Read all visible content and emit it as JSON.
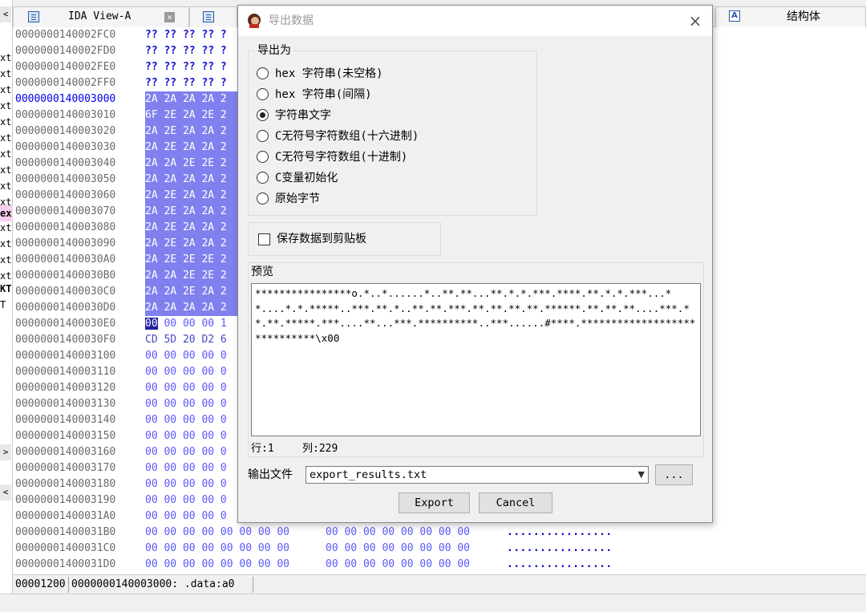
{
  "gutter": {
    "top_button": "<",
    "items": [
      "xt",
      "xt",
      "xt",
      "xt",
      "xt",
      "xt",
      "xt",
      "xt",
      "xt",
      "xt",
      "ex",
      "xt",
      "xt",
      "xt",
      "xt",
      "KT",
      "T"
    ],
    "mid_button": ">",
    "low_button": "<"
  },
  "tabs": {
    "ida_view_label": "IDA View-A",
    "close_glyph": "×",
    "struct_label": "结构体",
    "struct_icon_letter": "A"
  },
  "hex_rows": [
    {
      "addr": "0000000140002FC0",
      "a": "?? ?? ?? ?? ?",
      "b": "",
      "ascii": ""
    },
    {
      "addr": "0000000140002FD0",
      "a": "?? ?? ?? ?? ?",
      "b": "",
      "ascii": ""
    },
    {
      "addr": "0000000140002FE0",
      "a": "?? ?? ?? ?? ?",
      "b": "",
      "ascii": ""
    },
    {
      "addr": "0000000140002FF0",
      "a": "?? ?? ?? ?? ?",
      "b": "",
      "ascii": ""
    },
    {
      "addr": "0000000140003000",
      "a": "2A 2A 2A 2A 2",
      "b": "",
      "ascii": ""
    },
    {
      "addr": "0000000140003010",
      "a": "6F 2E 2A 2E 2",
      "b": "",
      "ascii": ""
    },
    {
      "addr": "0000000140003020",
      "a": "2A 2E 2A 2A 2",
      "b": "",
      "ascii": ""
    },
    {
      "addr": "0000000140003030",
      "a": "2A 2E 2A 2A 2",
      "b": "",
      "ascii": ""
    },
    {
      "addr": "0000000140003040",
      "a": "2A 2A 2E 2E 2",
      "b": "",
      "ascii": ""
    },
    {
      "addr": "0000000140003050",
      "a": "2A 2A 2A 2A 2",
      "b": "",
      "ascii": ""
    },
    {
      "addr": "0000000140003060",
      "a": "2A 2E 2A 2A 2",
      "b": "",
      "ascii": ""
    },
    {
      "addr": "0000000140003070",
      "a": "2A 2E 2A 2A 2",
      "b": "",
      "ascii": ""
    },
    {
      "addr": "0000000140003080",
      "a": "2A 2E 2A 2A 2",
      "b": "",
      "ascii": ""
    },
    {
      "addr": "0000000140003090",
      "a": "2A 2E 2A 2A 2",
      "b": "",
      "ascii": ""
    },
    {
      "addr": "00000001400030A0",
      "a": "2A 2E 2E 2E 2",
      "b": "",
      "ascii": ""
    },
    {
      "addr": "00000001400030B0",
      "a": "2A 2A 2E 2E 2",
      "b": "",
      "ascii": ""
    },
    {
      "addr": "00000001400030C0",
      "a": "2A 2A 2E 2A 2",
      "b": "",
      "ascii": ""
    },
    {
      "addr": "00000001400030D0",
      "a": "2A 2A 2A 2A 2",
      "b": "",
      "ascii": ""
    },
    {
      "addr": "00000001400030E0",
      "a": "00 00 00 00 1",
      "b": "",
      "ascii": ""
    },
    {
      "addr": "00000001400030F0",
      "a": "CD 5D 20 D2 6",
      "b": "",
      "ascii": ""
    },
    {
      "addr": "0000000140003100",
      "a": "00 00 00 00 0",
      "b": "",
      "ascii": ""
    },
    {
      "addr": "0000000140003110",
      "a": "00 00 00 00 0",
      "b": "",
      "ascii": ""
    },
    {
      "addr": "0000000140003120",
      "a": "00 00 00 00 0",
      "b": "",
      "ascii": ""
    },
    {
      "addr": "0000000140003130",
      "a": "00 00 00 00 0",
      "b": "",
      "ascii": ""
    },
    {
      "addr": "0000000140003140",
      "a": "00 00 00 00 0",
      "b": "",
      "ascii": ""
    },
    {
      "addr": "0000000140003150",
      "a": "00 00 00 00 0",
      "b": "",
      "ascii": ""
    },
    {
      "addr": "0000000140003160",
      "a": "00 00 00 00 0",
      "b": "",
      "ascii": ""
    },
    {
      "addr": "0000000140003170",
      "a": "00 00 00 00 0",
      "b": "",
      "ascii": ""
    },
    {
      "addr": "0000000140003180",
      "a": "00 00 00 00 0",
      "b": "",
      "ascii": ""
    },
    {
      "addr": "0000000140003190",
      "a": "00 00 00 00 0",
      "b": "",
      "ascii": ""
    },
    {
      "addr": "00000001400031A0",
      "a": "00 00 00 00 0",
      "b": "",
      "ascii": ""
    },
    {
      "addr": "00000001400031B0",
      "a": "00 00 00 00 00 00 00 00",
      "b": "00 00 00 00 00 00 00 00",
      "ascii": "................"
    },
    {
      "addr": "00000001400031C0",
      "a": "00 00 00 00 00 00 00 00",
      "b": "00 00 00 00 00 00 00 00",
      "ascii": "................"
    },
    {
      "addr": "00000001400031D0",
      "a": "00 00 00 00 00 00 00 00",
      "b": "00 00 00 00 00 00 00 00",
      "ascii": "................"
    }
  ],
  "status_bar": {
    "offset": "00001200",
    "location": "0000000140003000: .data:a0"
  },
  "dialog": {
    "title": "导出数据",
    "close_glyph": "×",
    "export_as": {
      "legend": "导出为",
      "options": [
        {
          "label": "hex 字符串(未空格)",
          "selected": false
        },
        {
          "label": "hex 字符串(间隔)",
          "selected": false
        },
        {
          "label": "字符串文字",
          "selected": true
        },
        {
          "label": "C无符号字符数组(十六进制)",
          "selected": false
        },
        {
          "label": "C无符号字符数组(十进制)",
          "selected": false
        },
        {
          "label": "C变量初始化",
          "selected": false
        },
        {
          "label": "原始字节",
          "selected": false
        }
      ]
    },
    "save_to_clipboard": {
      "label": "保存数据到剪贴板",
      "checked": false
    },
    "preview": {
      "legend": "预览",
      "text": "****************o.*..*......*..**.**...**.*.*.***.****.**.*.*.***...**....*.*.*****..***.**.*..**.**.***.**.**.**.**.******.**.**.**....***.**.**.*****.***....**...***.**********..***......#****.*****************************\\x00",
      "row_label": "行:1",
      "col_label": "列:229"
    },
    "output_file": {
      "label": "输出文件",
      "value": "export_results.txt",
      "browse_label": "..."
    },
    "export_label": "Export",
    "cancel_label": "Cancel"
  }
}
